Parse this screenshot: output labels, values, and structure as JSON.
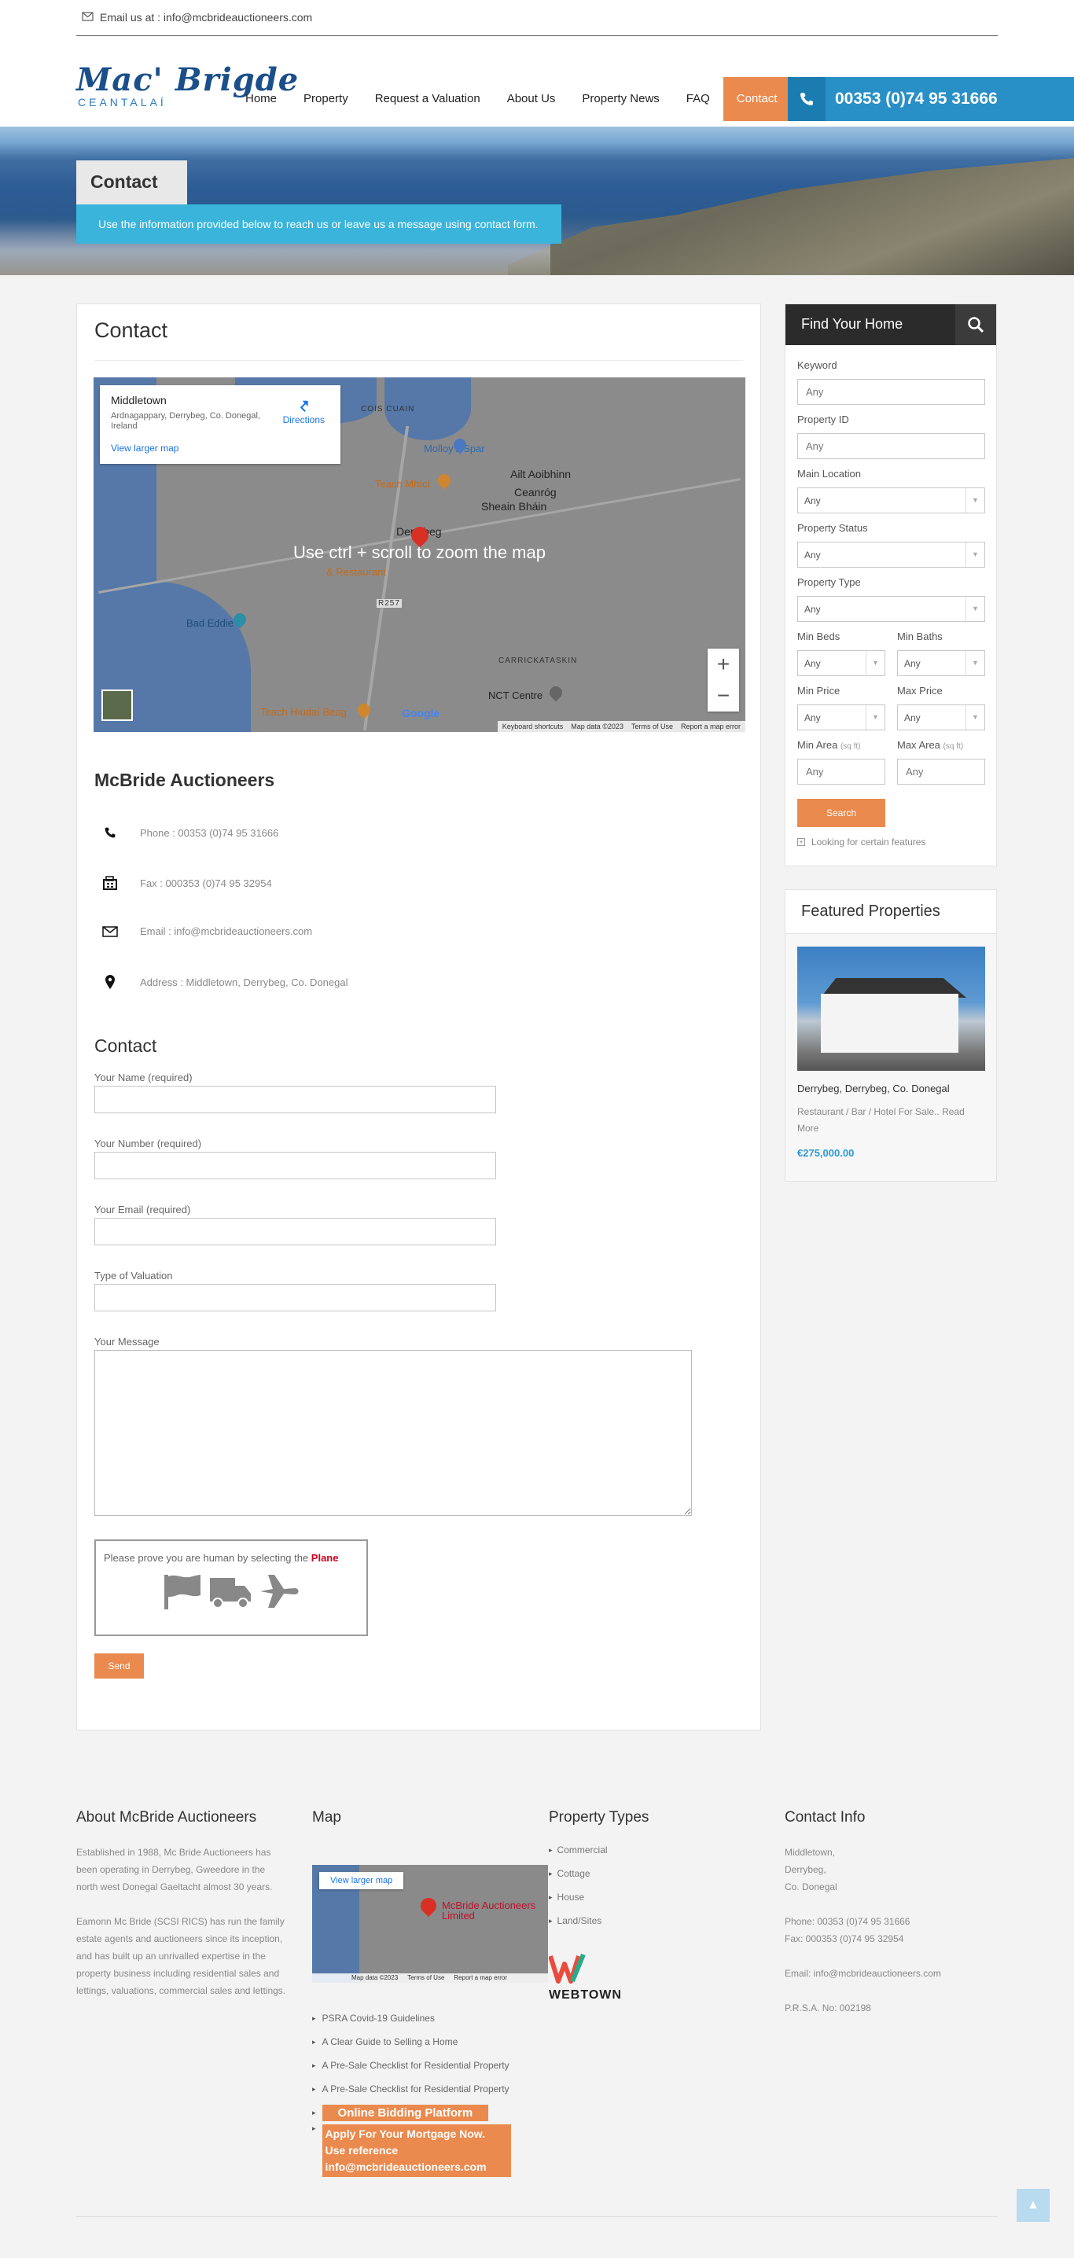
{
  "topbar": {
    "email": "Email us at : info@mcbrideauctioneers.com"
  },
  "brand": {
    "name": "Mac' Brigde",
    "sub": "CEANTALAÍ"
  },
  "nav": [
    "Home",
    "Property",
    "Request a Valuation",
    "About Us",
    "Property News",
    "FAQ",
    "Contact"
  ],
  "phone": "00353 (0)74 95 31666",
  "banner": {
    "title": "Contact",
    "desc": "Use the information provided below to reach us or leave us a message using contact form."
  },
  "main": {
    "title": "Contact"
  },
  "map": {
    "place": "Middletown",
    "address": "Ardnagappary, Derrybeg, Co. Donegal, Ireland",
    "directions": "Directions",
    "view_larger": "View larger map",
    "overlay": "Use ctrl + scroll to zoom the map",
    "labels": {
      "cois_cuain": "COIS CUAIN",
      "molloys": "Molloy's Spar",
      "teach_mhici": "Teach Mhící",
      "ailt": "Ailt Aoibhinn",
      "ceanog": "Ceanróg",
      "sheain": "Sheain Bháin",
      "derrybeg": "Derrybeg",
      "restaurant": "& Restaurant",
      "r257": "R257",
      "bad_eddie": "Bad Eddie",
      "carrick": "CARRICKATASKIN",
      "nct": "NCT Centre",
      "teach_hiudai": "Teach Hiudaí Beag"
    },
    "footer": [
      "Keyboard shortcuts",
      "Map data ©2023",
      "Terms of Use",
      "Report a map error"
    ],
    "google": "Google"
  },
  "company": "McBride Auctioneers",
  "contacts": [
    {
      "icon": "phone-icon",
      "text": "Phone : 00353 (0)74 95 31666"
    },
    {
      "icon": "fax-icon",
      "text": "Fax : 000353 (0)74 95 32954"
    },
    {
      "icon": "envelope-icon",
      "text": "Email : info@mcbrideauctioneers.com"
    },
    {
      "icon": "pin-icon",
      "text": "Address : Middletown, Derrybeg, Co. Donegal"
    }
  ],
  "form": {
    "title": "Contact",
    "name_label": "Your Name (required)",
    "number_label": "Your Number (required)",
    "email_label": "Your Email (required)",
    "valuation_label": "Type of Valuation",
    "message_label": "Your Message",
    "captcha_prompt": "Please prove you are human by selecting the",
    "captcha_target": "Plane",
    "send": "Send"
  },
  "search": {
    "title": "Find Your Home",
    "keyword_label": "Keyword",
    "keyword_ph": "Any",
    "pid_label": "Property ID",
    "pid_ph": "Any",
    "location_label": "Main Location",
    "location_val": "Any",
    "status_label": "Property Status",
    "status_val": "Any",
    "type_label": "Property Type",
    "type_val": "Any",
    "minbeds_label": "Min Beds",
    "minbeds_val": "Any",
    "minbaths_label": "Min Baths",
    "minbaths_val": "Any",
    "minprice_label": "Min Price",
    "minprice_val": "Any",
    "maxprice_label": "Max Price",
    "maxprice_val": "Any",
    "minarea_label": "Min Area",
    "maxarea_label": "Max Area",
    "area_unit": "(sq ft)",
    "minarea_ph": "Any",
    "maxarea_ph": "Any",
    "button": "Search",
    "features": "Looking for certain features"
  },
  "featured": {
    "title": "Featured Properties",
    "property_title": "Derrybeg, Derrybeg, Co. Donegal",
    "property_desc": "Restaurant / Bar / Hotel For Sale.. Read More",
    "price": "€275,000.00"
  },
  "footer": {
    "about_title": "About McBride Auctioneers",
    "about_p1": "Established in 1988, Mc Bride Auctioneers has been operating in Derrybeg, Gweedore in the north west Donegal Gaeltacht almost 30 years.",
    "about_p2": "Eamonn Mc Bride (SCSI RICS) has run the family estate agents and auctioneers since its inception, and has built up an unrivalled expertise in the property business including residential sales and lettings, valuations, commercial sales and lettings.",
    "map_title": "Map",
    "map_view": "View larger map",
    "map_label": "McBride Auctioneers Limited",
    "map_footer": [
      "Map data ©2023",
      "Terms of Use",
      "Report a map error"
    ],
    "links": [
      "PSRA Covid-19 Guidelines",
      "A Clear Guide to Selling a Home",
      "A Pre-Sale Checklist for Residential Property",
      "A Pre-Sale Checklist for Residential Property"
    ],
    "online_bidding": "Online Bidding Platform",
    "mortgage": "Apply For Your Mortgage Now. Use reference info@mcbrideauctioneers.com",
    "types_title": "Property Types",
    "types": [
      "Commercial",
      "Cottage",
      "House",
      "Land/Sites"
    ],
    "webtown": "WEBTOWN",
    "contact_title": "Contact Info",
    "addr1": "Middletown,",
    "addr2": "Derrybeg,",
    "addr3": "Co. Donegal",
    "phone": "Phone: 00353 (0)74 95 31666",
    "fax": "Fax: 000353 (0)74 95 32954",
    "email": "Email: info@mcbrideauctioneers.com",
    "psra": "P.R.S.A. No: 002198"
  },
  "colors": {
    "accent": "#ea8a4e",
    "blue": "#2990c7",
    "banner_desc": "#3ab4da",
    "price": "#2b9ad6"
  }
}
